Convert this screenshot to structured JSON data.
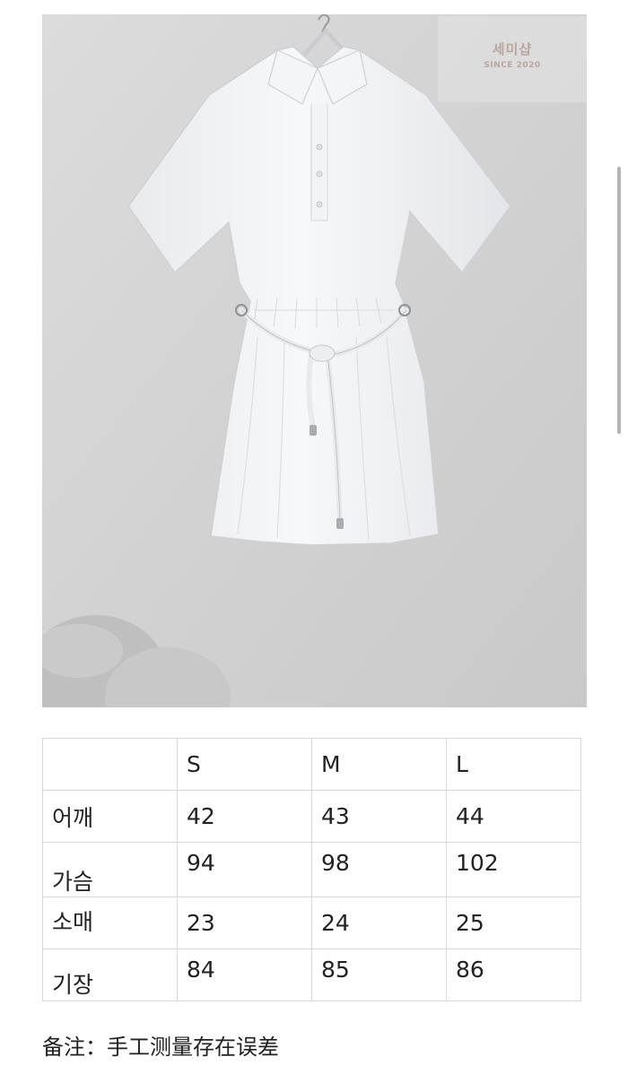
{
  "watermark": {
    "brand": "세미샵",
    "since": "SINCE 2020"
  },
  "size_table": {
    "header": [
      "",
      "S",
      "M",
      "L"
    ],
    "rows": [
      [
        "어깨",
        "42",
        "43",
        "44"
      ],
      [
        "가슴",
        "94",
        "98",
        "102"
      ],
      [
        "소매",
        "23",
        "24",
        "25"
      ],
      [
        "기장",
        "84",
        "85",
        "86"
      ]
    ]
  },
  "note": "备注：手工测量存在误差"
}
